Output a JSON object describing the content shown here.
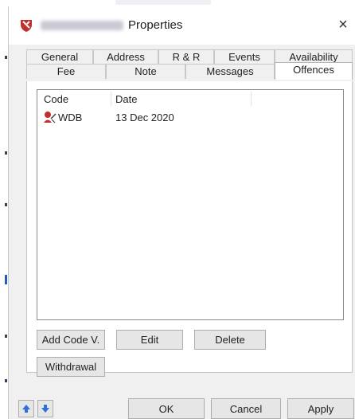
{
  "window": {
    "title": "Properties",
    "close_glyph": "×"
  },
  "tabs": {
    "row1": [
      "General",
      "Address",
      "R & R",
      "Events",
      "Availability"
    ],
    "row2": [
      "Fee",
      "Note",
      "Messages",
      "Offences"
    ],
    "selected": "Offences"
  },
  "list": {
    "columns": [
      "Code",
      "Date"
    ],
    "rows": [
      {
        "code": "WDB",
        "date": "13 Dec 2020",
        "icon": "offence-icon"
      }
    ]
  },
  "panel_buttons": {
    "add_code": "Add Code V.",
    "edit": "Edit",
    "delete": "Delete",
    "withdrawal": "Withdrawal"
  },
  "footer": {
    "ok": "OK",
    "cancel": "Cancel",
    "apply": "Apply",
    "up_icon": "arrow-up-icon",
    "down_icon": "arrow-down-icon"
  },
  "colors": {
    "accent_blue": "#2f6fd6",
    "icon_red": "#c0302e",
    "dialog_bg": "#f0f0f0"
  }
}
